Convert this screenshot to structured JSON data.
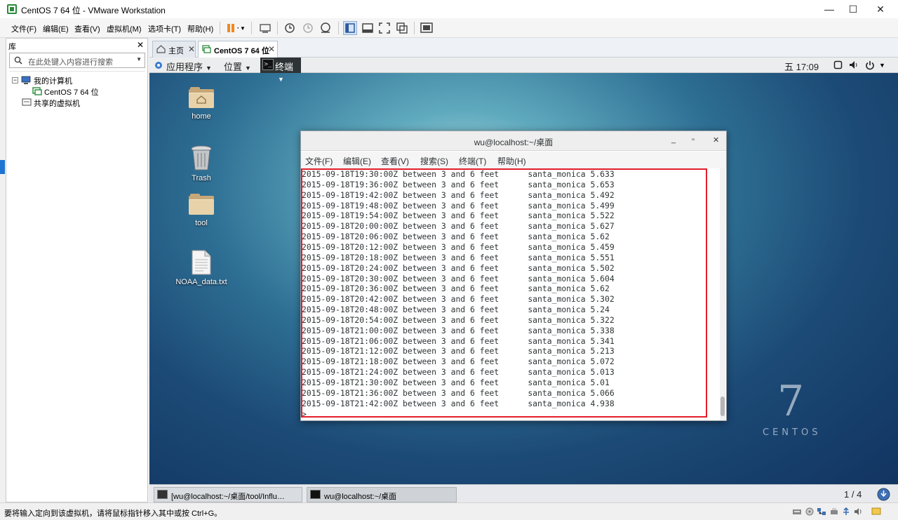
{
  "window": {
    "title": "CentOS 7 64 位 - VMware Workstation",
    "controls": [
      "—",
      "☐",
      "✕"
    ]
  },
  "menubar": {
    "items": [
      "文件(F)",
      "编辑(E)",
      "查看(V)",
      "虚拟机(M)",
      "选项卡(T)",
      "帮助(H)"
    ]
  },
  "library": {
    "title": "库",
    "search_placeholder": "在此处键入内容进行搜索",
    "tree": {
      "root": "我的计算机",
      "vm": "CentOS 7 64 位",
      "shared": "共享的虚拟机"
    }
  },
  "tabs": [
    {
      "label": "主页"
    },
    {
      "label": "CentOS 7 64 位"
    }
  ],
  "gnome": {
    "applications": "应用程序",
    "places": "位置",
    "terminal": "终端",
    "clock": "五 17:09"
  },
  "desktop": {
    "icons": [
      {
        "label": "home"
      },
      {
        "label": "Trash"
      },
      {
        "label": "tool"
      },
      {
        "label": "NOAA_data.txt"
      }
    ],
    "watermark_number": "7",
    "watermark_text": "CENTOS"
  },
  "terminal": {
    "title": "wu@localhost:~/桌面",
    "menu": [
      "文件(F)",
      "编辑(E)",
      "查看(V)",
      "搜索(S)",
      "终端(T)",
      "帮助(H)"
    ],
    "lines": [
      "2015-09-18T19:30:00Z between 3 and 6 feet      santa_monica 5.633",
      "2015-09-18T19:36:00Z between 3 and 6 feet      santa_monica 5.653",
      "2015-09-18T19:42:00Z between 3 and 6 feet      santa_monica 5.492",
      "2015-09-18T19:48:00Z between 3 and 6 feet      santa_monica 5.499",
      "2015-09-18T19:54:00Z between 3 and 6 feet      santa_monica 5.522",
      "2015-09-18T20:00:00Z between 3 and 6 feet      santa_monica 5.627",
      "2015-09-18T20:06:00Z between 3 and 6 feet      santa_monica 5.62",
      "2015-09-18T20:12:00Z between 3 and 6 feet      santa_monica 5.459",
      "2015-09-18T20:18:00Z between 3 and 6 feet      santa_monica 5.551",
      "2015-09-18T20:24:00Z between 3 and 6 feet      santa_monica 5.502",
      "2015-09-18T20:30:00Z between 3 and 6 feet      santa_monica 5.604",
      "2015-09-18T20:36:00Z between 3 and 6 feet      santa_monica 5.62",
      "2015-09-18T20:42:00Z between 3 and 6 feet      santa_monica 5.302",
      "2015-09-18T20:48:00Z between 3 and 6 feet      santa_monica 5.24",
      "2015-09-18T20:54:00Z between 3 and 6 feet      santa_monica 5.322",
      "2015-09-18T21:00:00Z between 3 and 6 feet      santa_monica 5.338",
      "2015-09-18T21:06:00Z between 3 and 6 feet      santa_monica 5.341",
      "2015-09-18T21:12:00Z between 3 and 6 feet      santa_monica 5.213",
      "2015-09-18T21:18:00Z between 3 and 6 feet      santa_monica 5.072",
      "2015-09-18T21:24:00Z between 3 and 6 feet      santa_monica 5.013",
      "2015-09-18T21:30:00Z between 3 and 6 feet      santa_monica 5.01",
      "2015-09-18T21:36:00Z between 3 and 6 feet      santa_monica 5.066",
      "2015-09-18T21:42:00Z between 3 and 6 feet      santa_monica 4.938",
      ">"
    ]
  },
  "taskbar": {
    "tasks": [
      {
        "label": "[wu@localhost:~/桌面/tool/Influ…"
      },
      {
        "label": "wu@localhost:~/桌面"
      }
    ],
    "workspace": "1 / 4"
  },
  "status": {
    "message": "要将输入定向到该虚拟机，请将鼠标指针移入其中或按 Ctrl+G。"
  },
  "colors": {
    "highlight": "#e21e2b",
    "accent": "#1e74d2"
  }
}
